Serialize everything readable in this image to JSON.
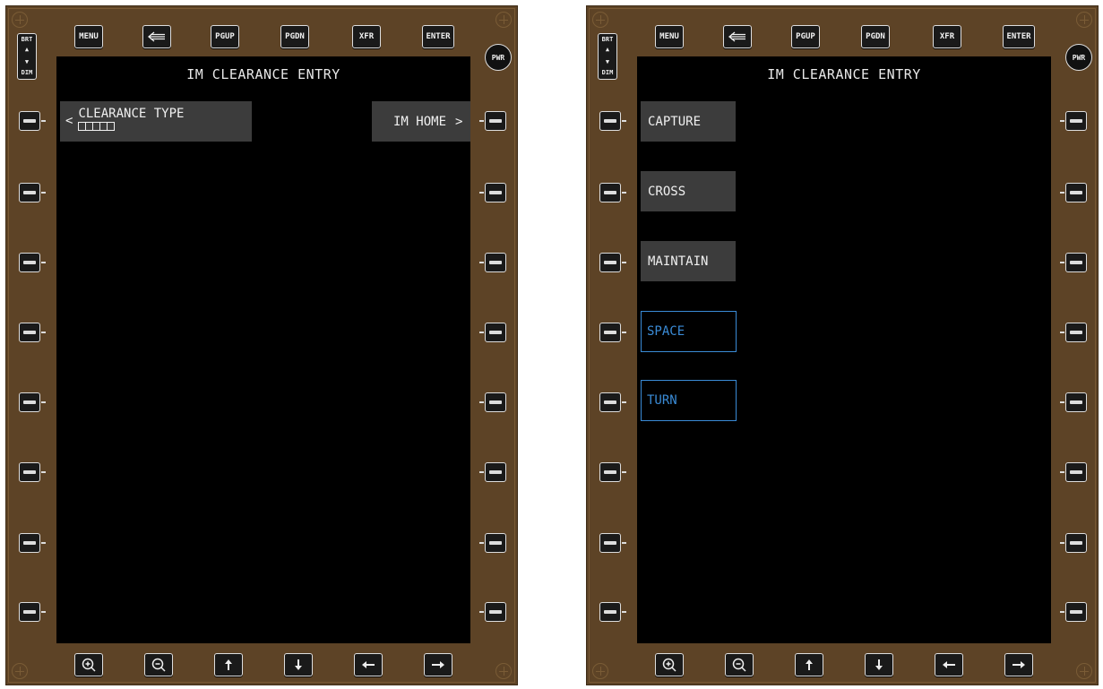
{
  "left": {
    "top_keys": [
      "MENU",
      "",
      "PGUP",
      "PGDN",
      "XFR",
      "ENTER"
    ],
    "top_icons": [
      "menu",
      "back-arrow-icon",
      "pgup",
      "pgdn",
      "xfr",
      "enter"
    ],
    "bright": "BRT",
    "dim": "DIM",
    "power": "PWR",
    "title": "IM CLEARANCE ENTRY",
    "clearance_type_label": "CLEARANCE TYPE",
    "clearance_type_prefix": "<",
    "im_home_label": "IM HOME",
    "im_home_suffix": ">",
    "bottom_icons": [
      "zoom-in-icon",
      "zoom-out-icon",
      "arrow-up-icon",
      "arrow-down-icon",
      "arrow-left-icon",
      "arrow-right-icon"
    ]
  },
  "right": {
    "top_keys": [
      "MENU",
      "",
      "PGUP",
      "PGDN",
      "XFR",
      "ENTER"
    ],
    "bright": "BRT",
    "dim": "DIM",
    "power": "PWR",
    "title": "IM CLEARANCE ENTRY",
    "options": [
      {
        "label": "CAPTURE",
        "style": "filled"
      },
      {
        "label": "CROSS",
        "style": "filled"
      },
      {
        "label": "MAINTAIN",
        "style": "filled"
      },
      {
        "label": "SPACE",
        "style": "outlined"
      },
      {
        "label": "TURN",
        "style": "outlined"
      }
    ]
  },
  "colors": {
    "bezel": "#5d4326",
    "screen": "#000000",
    "field": "#3c3c3c",
    "accent": "#3a8bd6"
  }
}
